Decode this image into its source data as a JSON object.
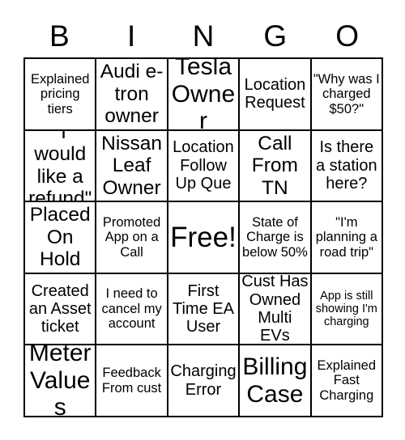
{
  "header": {
    "letters": [
      "B",
      "I",
      "N",
      "G",
      "O"
    ]
  },
  "grid": {
    "columns": 5,
    "rows": 5,
    "cells": [
      {
        "text": "Explained pricing tiers",
        "size": "s"
      },
      {
        "text": "Audi e-tron owner",
        "size": "l"
      },
      {
        "text": "Tesla Owner",
        "size": "xl"
      },
      {
        "text": "Location Request",
        "size": "m"
      },
      {
        "text": "\"Why was I charged $50?\"",
        "size": "s"
      },
      {
        "text": "\"I would like a refund\"",
        "size": "l"
      },
      {
        "text": "Nissan Leaf Owner",
        "size": "l"
      },
      {
        "text": "Location Follow Up Que",
        "size": "m"
      },
      {
        "text": "Call From TN",
        "size": "l"
      },
      {
        "text": "Is there a station here?",
        "size": "m"
      },
      {
        "text": "Placed On Hold",
        "size": "l"
      },
      {
        "text": "Promoted App on a Call",
        "size": "s"
      },
      {
        "text": "Free!",
        "size": "xxl"
      },
      {
        "text": "State of Charge is below 50%",
        "size": "s"
      },
      {
        "text": "\"I'm planning a road trip\"",
        "size": "s"
      },
      {
        "text": "Created an Asset ticket",
        "size": "m"
      },
      {
        "text": "I need to cancel my account",
        "size": "s"
      },
      {
        "text": "First Time EA User",
        "size": "m"
      },
      {
        "text": "Cust Has Owned Multi EVs",
        "size": "m"
      },
      {
        "text": "App is still showing I'm charging",
        "size": "xs"
      },
      {
        "text": "Meter Values",
        "size": "xl"
      },
      {
        "text": "Feedback From cust",
        "size": "s"
      },
      {
        "text": "Charging Error",
        "size": "m"
      },
      {
        "text": "Billing Case",
        "size": "xl"
      },
      {
        "text": "Explained Fast Charging",
        "size": "s"
      }
    ]
  }
}
